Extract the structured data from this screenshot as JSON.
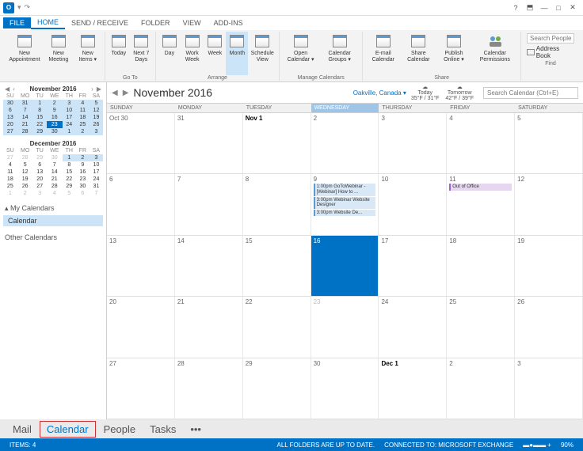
{
  "titlebar": {
    "appicon": "O"
  },
  "menubar": {
    "tabs": [
      "FILE",
      "HOME",
      "SEND / RECEIVE",
      "FOLDER",
      "VIEW",
      "ADD-INS"
    ]
  },
  "ribbon": {
    "new": {
      "appointment": "New\nAppointment",
      "meeting": "New\nMeeting",
      "items": "New\nItems ▾",
      "label": ""
    },
    "goto": {
      "today": "Today",
      "next7": "Next 7\nDays",
      "label": "Go To"
    },
    "arrange": {
      "day": "Day",
      "workweek": "Work\nWeek",
      "week": "Week",
      "month": "Month",
      "schedule": "Schedule\nView",
      "label": "Arrange"
    },
    "manage": {
      "open": "Open\nCalendar ▾",
      "groups": "Calendar\nGroups ▾",
      "label": "Manage Calendars"
    },
    "share": {
      "email": "E-mail\nCalendar",
      "share": "Share\nCalendar",
      "publish": "Publish\nOnline ▾",
      "perms": "Calendar\nPermissions",
      "label": "Share"
    },
    "find": {
      "search_placeholder": "Search People",
      "addressbook": "Address Book",
      "label": "Find"
    }
  },
  "sidebar": {
    "nov": {
      "title": "November 2016",
      "dow": [
        "SU",
        "MO",
        "TU",
        "WE",
        "TH",
        "FR",
        "SA"
      ],
      "rows": [
        [
          "30",
          "31",
          "1",
          "2",
          "3",
          "4",
          "5"
        ],
        [
          "6",
          "7",
          "8",
          "9",
          "10",
          "11",
          "12"
        ],
        [
          "13",
          "14",
          "15",
          "16",
          "17",
          "18",
          "19"
        ],
        [
          "20",
          "21",
          "22",
          "23",
          "24",
          "25",
          "26"
        ],
        [
          "27",
          "28",
          "29",
          "30",
          "1",
          "2",
          "3"
        ]
      ]
    },
    "dec": {
      "title": "December 2016",
      "dow": [
        "SU",
        "MO",
        "TU",
        "WE",
        "TH",
        "FR",
        "SA"
      ],
      "rows": [
        [
          "27",
          "28",
          "29",
          "30",
          "1",
          "2",
          "3"
        ],
        [
          "4",
          "5",
          "6",
          "7",
          "8",
          "9",
          "10"
        ],
        [
          "11",
          "12",
          "13",
          "14",
          "15",
          "16",
          "17"
        ],
        [
          "18",
          "19",
          "20",
          "21",
          "22",
          "23",
          "24"
        ],
        [
          "25",
          "26",
          "27",
          "28",
          "29",
          "30",
          "31"
        ],
        [
          "1",
          "2",
          "3",
          "4",
          "5",
          "6",
          "7"
        ]
      ]
    },
    "mycals": "▴ My Calendars",
    "calendar": "Calendar",
    "other": "Other Calendars"
  },
  "main": {
    "title": "November 2016",
    "location": "Oakville, Canada ▾",
    "weather": {
      "today": {
        "label": "Today",
        "temp": "35°F / 31°F"
      },
      "tomorrow": {
        "label": "Tomorrow",
        "temp": "42°F / 39°F"
      }
    },
    "search_placeholder": "Search Calendar (Ctrl+E)",
    "days": [
      "SUNDAY",
      "MONDAY",
      "TUESDAY",
      "WEDNESDAY",
      "THURSDAY",
      "FRIDAY",
      "SATURDAY"
    ],
    "weeks": [
      [
        {
          "d": "Oct 30"
        },
        {
          "d": "31"
        },
        {
          "d": "Nov 1",
          "b": 1
        },
        {
          "d": "2"
        },
        {
          "d": "3"
        },
        {
          "d": "4"
        },
        {
          "d": "5"
        }
      ],
      [
        {
          "d": "6"
        },
        {
          "d": "7"
        },
        {
          "d": "8"
        },
        {
          "d": "9",
          "events": [
            {
              "t": "1:00pm GoToWebinar - [Webinar] How to ..."
            },
            {
              "t": "3:00pm Webinar Website Designer"
            },
            {
              "t": "3:00pm Website De..."
            }
          ]
        },
        {
          "d": "10"
        },
        {
          "d": "11",
          "events": [
            {
              "t": "Out of Office",
              "oof": 1
            }
          ]
        },
        {
          "d": "12"
        }
      ],
      [
        {
          "d": "13"
        },
        {
          "d": "14"
        },
        {
          "d": "15"
        },
        {
          "d": "16",
          "today": 1
        },
        {
          "d": "17"
        },
        {
          "d": "18"
        },
        {
          "d": "19"
        }
      ],
      [
        {
          "d": "20"
        },
        {
          "d": "21"
        },
        {
          "d": "22"
        },
        {
          "d": "23",
          "dim": 1
        },
        {
          "d": "24"
        },
        {
          "d": "25"
        },
        {
          "d": "26"
        }
      ],
      [
        {
          "d": "27"
        },
        {
          "d": "28"
        },
        {
          "d": "29"
        },
        {
          "d": "30"
        },
        {
          "d": "Dec 1",
          "b": 1
        },
        {
          "d": "2"
        },
        {
          "d": "3"
        }
      ]
    ]
  },
  "bottomnav": [
    "Mail",
    "Calendar",
    "People",
    "Tasks",
    "•••"
  ],
  "status": {
    "items": "ITEMS: 4",
    "folders": "ALL FOLDERS ARE UP TO DATE.",
    "connected": "CONNECTED TO: MICROSOFT EXCHANGE",
    "zoom": "90%"
  }
}
